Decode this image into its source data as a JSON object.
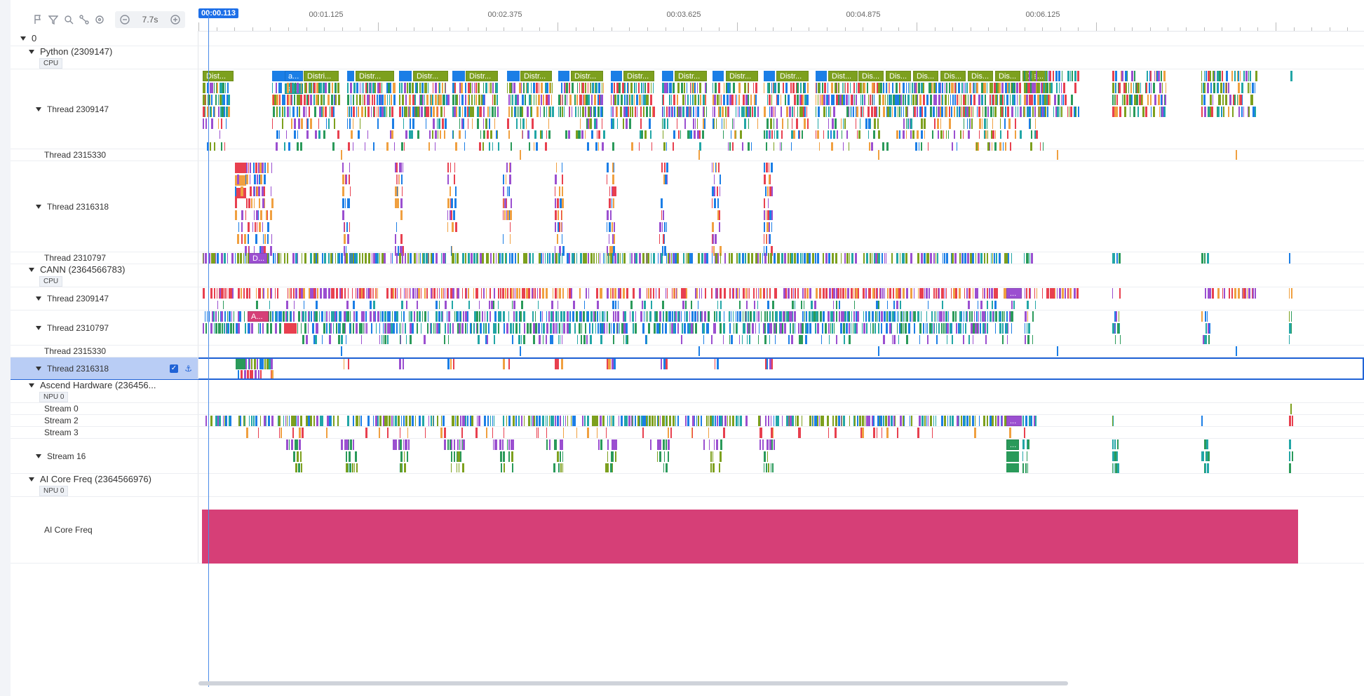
{
  "toolbar": {
    "icons": [
      "flag-icon",
      "filter-icon",
      "search-icon",
      "link-icon",
      "reset-icon"
    ],
    "zoom_label": "7.7s"
  },
  "ruler": {
    "cursor": "00:00.113",
    "ticks": [
      "00:01.125",
      "00:02.375",
      "00:03.625",
      "00:04.875",
      "00:06.125"
    ]
  },
  "lanes": {
    "root": "0",
    "python": {
      "name": "Python (2309147)",
      "tag": "CPU"
    },
    "py_t1": "Thread 2309147",
    "py_t2": "Thread 2315330",
    "py_t3": "Thread 2316318",
    "py_t4": "Thread 2310797",
    "cann": {
      "name": "CANN (2364566783)",
      "tag": "CPU"
    },
    "cann_t1": "Thread 2309147",
    "cann_t2": "Thread 2310797",
    "cann_t3": "Thread 2315330",
    "cann_t4": "Thread 2316318",
    "ascend": {
      "name": "Ascend Hardware (236456...",
      "tag": "NPU 0"
    },
    "stream0": "Stream 0",
    "stream2": "Stream 2",
    "stream3": "Stream 3",
    "stream16": "Stream 16",
    "aicore": {
      "name": "AI Core Freq (2364566976)",
      "tag": "NPU 0"
    },
    "aicore_freq": "AI Core Freq"
  },
  "slices": {
    "dist": "Dist...",
    "a": "a...",
    "distri": "Distri...",
    "distr": "Distr...",
    "dis": "Dis...",
    "d": "D...",
    "ad": "A...",
    "ellipsis": "..."
  },
  "colors": {
    "accent": "#1d6fe8",
    "olive": "#7da01e",
    "blue": "#1b7ee6",
    "teal": "#22a6a6",
    "purple": "#9b4fd0",
    "red": "#e8404f",
    "orange": "#f0a040",
    "green": "#2a9a5a",
    "magenta": "#d63f77"
  }
}
